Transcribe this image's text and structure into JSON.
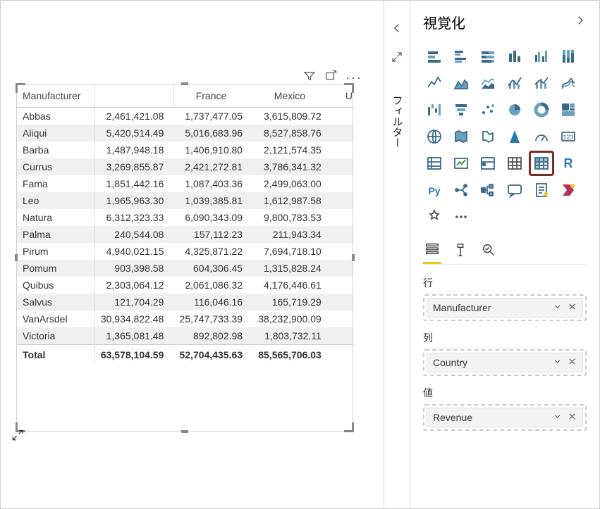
{
  "pane": {
    "title": "視覚化",
    "filters_label": "フィルター",
    "sections": {
      "rows": {
        "label": "行",
        "field": "Manufacturer"
      },
      "columns": {
        "label": "列",
        "field": "Country"
      },
      "values": {
        "label": "値",
        "field": "Revenue"
      }
    },
    "selected_visual": "matrix"
  },
  "matrix": {
    "row_header": "Manufacturer",
    "columns": [
      "France",
      "Mexico"
    ],
    "partial_column": "U",
    "rows": [
      {
        "label": "Abbas",
        "values": [
          "2,461,421.08",
          "1,737,477.05",
          "3,615,809.72"
        ]
      },
      {
        "label": "Aliqui",
        "values": [
          "5,420,514.49",
          "5,016,683.96",
          "8,527,858.76"
        ]
      },
      {
        "label": "Barba",
        "values": [
          "1,487,948.18",
          "1,406,910.80",
          "2,121,574.35"
        ]
      },
      {
        "label": "Currus",
        "values": [
          "3,269,855.87",
          "2,421,272.81",
          "3,786,341.32"
        ]
      },
      {
        "label": "Fama",
        "values": [
          "1,851,442.16",
          "1,087,403.36",
          "2,499,063.00"
        ]
      },
      {
        "label": "Leo",
        "values": [
          "1,965,963.30",
          "1,039,385.81",
          "1,612,987.58"
        ]
      },
      {
        "label": "Natura",
        "values": [
          "6,312,323.33",
          "6,090,343.09",
          "9,800,783.53"
        ]
      },
      {
        "label": "Palma",
        "values": [
          "240,544.08",
          "157,112.23",
          "211,943.34"
        ]
      },
      {
        "label": "Pirum",
        "values": [
          "4,940,021.15",
          "4,325,871.22",
          "7,694,718.10"
        ]
      },
      {
        "label": "Pomum",
        "values": [
          "903,398.58",
          "604,306.45",
          "1,315,828.24"
        ]
      },
      {
        "label": "Quibus",
        "values": [
          "2,303,064.12",
          "2,061,086.32",
          "4,176,446.61"
        ]
      },
      {
        "label": "Salvus",
        "values": [
          "121,704.29",
          "116,046.16",
          "165,719.29"
        ]
      },
      {
        "label": "VanArsdel",
        "values": [
          "30,934,822.48",
          "25,747,733.39",
          "38,232,900.09"
        ]
      },
      {
        "label": "Victoria",
        "values": [
          "1,365,081.48",
          "892,802.98",
          "1,803,732.11"
        ]
      }
    ],
    "total": {
      "label": "Total",
      "values": [
        "63,578,104.59",
        "52,704,435.63",
        "85,565,706.03"
      ]
    }
  },
  "gallery": [
    "stacked-bar",
    "clustered-bar",
    "stacked-100-bar",
    "stacked-column",
    "clustered-column",
    "stacked-100-column",
    "line",
    "area",
    "stacked-area",
    "line-clustered",
    "line-stacked",
    "ribbon",
    "waterfall",
    "funnel",
    "scatter",
    "pie",
    "donut",
    "treemap",
    "map",
    "filled-map",
    "shape-map",
    "arcgis",
    "gauge",
    "card",
    "multi-row-card",
    "kpi",
    "slicer",
    "table",
    "matrix",
    "r-visual",
    "python",
    "key-influencers",
    "decomposition-tree",
    "qa",
    "paginated",
    "powerapps",
    "custom",
    "more"
  ]
}
